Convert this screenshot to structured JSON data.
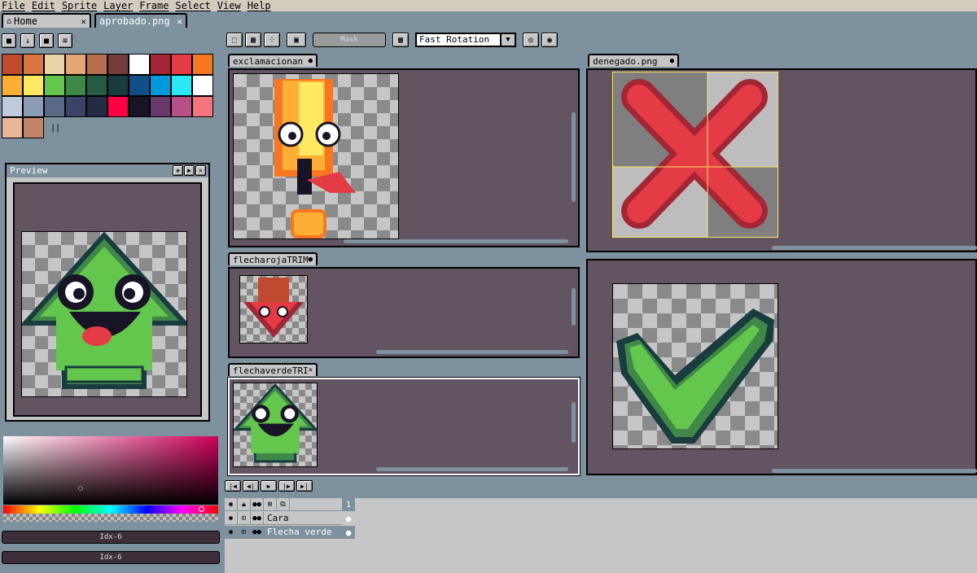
{
  "menu": [
    "File",
    "Edit",
    "Sprite",
    "Layer",
    "Frame",
    "Select",
    "View",
    "Help"
  ],
  "tabs": {
    "home": "Home",
    "active": "aprobado.png"
  },
  "toolbar": {
    "mask_label": "Mask",
    "rotation_value": "Fast Rotation"
  },
  "panels": {
    "exclamation": "exclamacionan",
    "flecharoja": "flecharojaTRIM",
    "flechaverde": "flechaverdeTRI",
    "denegado": "denegado.png",
    "preview": "Preview"
  },
  "palette": [
    "#be4a2f",
    "#d77643",
    "#ead4aa",
    "#e4a672",
    "#b86f50",
    "#733e39",
    "#ffffff",
    "#a22633",
    "#e43b44",
    "#f77622",
    "#feae34",
    "#fee761",
    "#63c74d",
    "#3e8948",
    "#265c42",
    "#193c3e",
    "#124e89",
    "#0099db",
    "#2ce8f5",
    "#ffffff",
    "#c0cbdc",
    "#8b9bb4",
    "#5a6988",
    "#3a4466",
    "#262b44",
    "#ff0044",
    "#181425",
    "#68386c",
    "#b55088",
    "#f6757a",
    "#e8b796",
    "#c28569"
  ],
  "color_indices": [
    "Idx-6",
    "Idx-6"
  ],
  "layers": {
    "frame_number": "1",
    "items": [
      "Cara",
      "Flecha verde"
    ]
  },
  "colors": {
    "panel_bg": "#625460",
    "ui_bg": "#7d929e",
    "chrome": "#c6c6c6",
    "menu": "#d3cbbe"
  }
}
